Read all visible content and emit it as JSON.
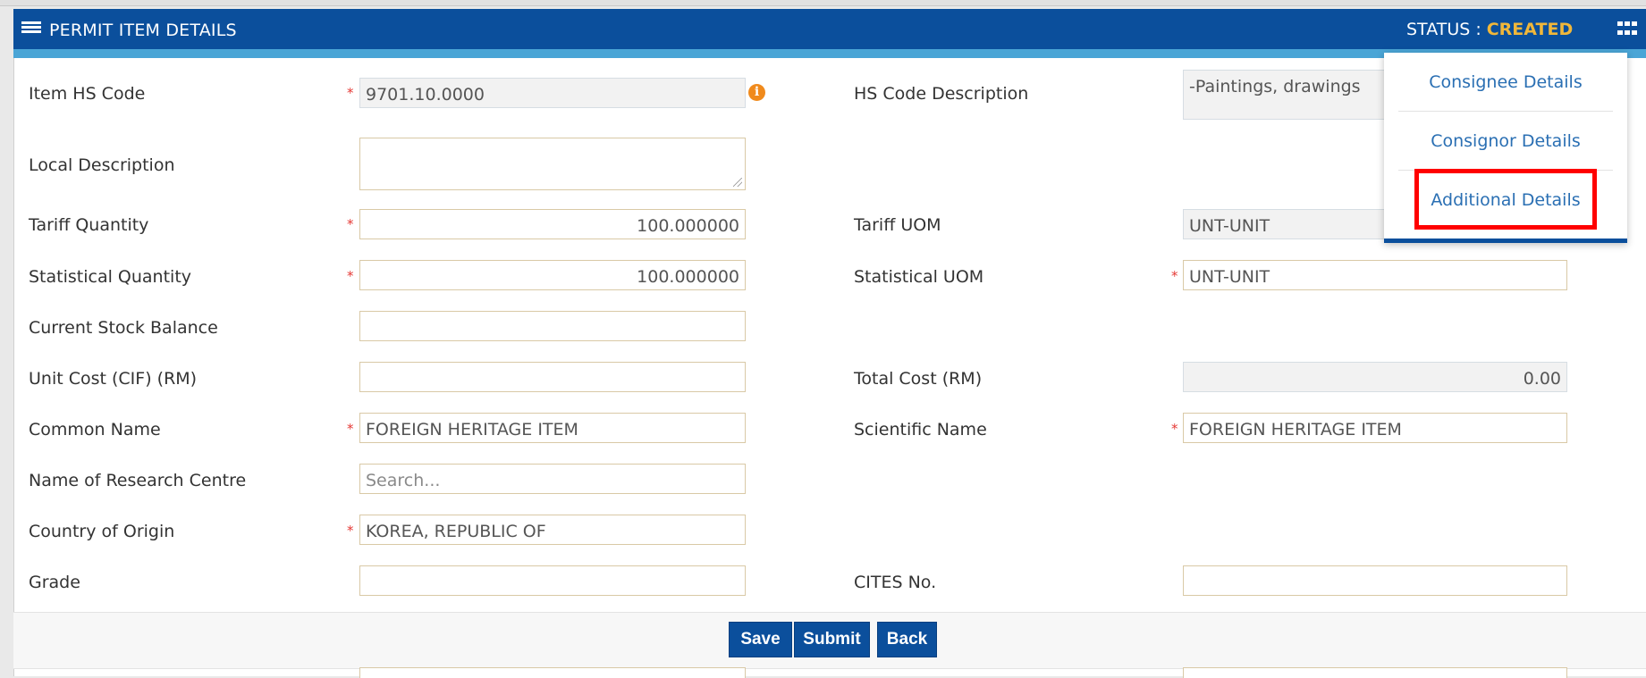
{
  "header": {
    "title": "PERMIT ITEM DETAILS",
    "status_label": "STATUS :",
    "status_value": "CREATED",
    "status_color": "#f0b73a",
    "accent_color": "#0b4f9c",
    "icons": [
      "menu-icon",
      "grid-icon",
      "minus-icon"
    ]
  },
  "form": {
    "item_hs_code": {
      "label": "Item HS Code",
      "value": "9701.10.0000",
      "required": true
    },
    "hs_code_description": {
      "label": "HS Code Description",
      "value": "-Paintings,  drawings"
    },
    "local_description": {
      "label": "Local Description",
      "value": ""
    },
    "tariff_quantity": {
      "label": "Tariff Quantity",
      "value": "100.000000",
      "required": true
    },
    "tariff_uom": {
      "label": "Tariff UOM",
      "value": "UNT-UNIT"
    },
    "statistical_quantity": {
      "label": "Statistical Quantity",
      "value": "100.000000",
      "required": true
    },
    "statistical_uom": {
      "label": "Statistical UOM",
      "value": "UNT-UNIT",
      "required": true
    },
    "current_stock_balance": {
      "label": "Current Stock Balance",
      "value": ""
    },
    "unit_cost": {
      "label": "Unit Cost (CIF) (RM)",
      "value": ""
    },
    "total_cost": {
      "label": "Total Cost (RM)",
      "value": "0.00"
    },
    "common_name": {
      "label": "Common Name",
      "value": "FOREIGN HERITAGE ITEM",
      "required": true
    },
    "scientific_name": {
      "label": "Scientific Name",
      "value": "FOREIGN HERITAGE ITEM",
      "required": true
    },
    "research_centre": {
      "label": "Name of Research Centre",
      "placeholder": "Search..."
    },
    "country_of_origin": {
      "label": "Country of Origin",
      "value": "KOREA, REPUBLIC OF",
      "required": true
    },
    "grade": {
      "label": "Grade",
      "value": ""
    },
    "cites_no": {
      "label": "CITES No.",
      "value": ""
    },
    "required_marker": "*"
  },
  "buttons": {
    "save": "Save",
    "submit": "Submit",
    "back": "Back"
  },
  "dropdown": {
    "items": [
      "Consignee Details",
      "Consignor Details",
      "Additional Details"
    ],
    "highlighted": "Additional Details"
  }
}
